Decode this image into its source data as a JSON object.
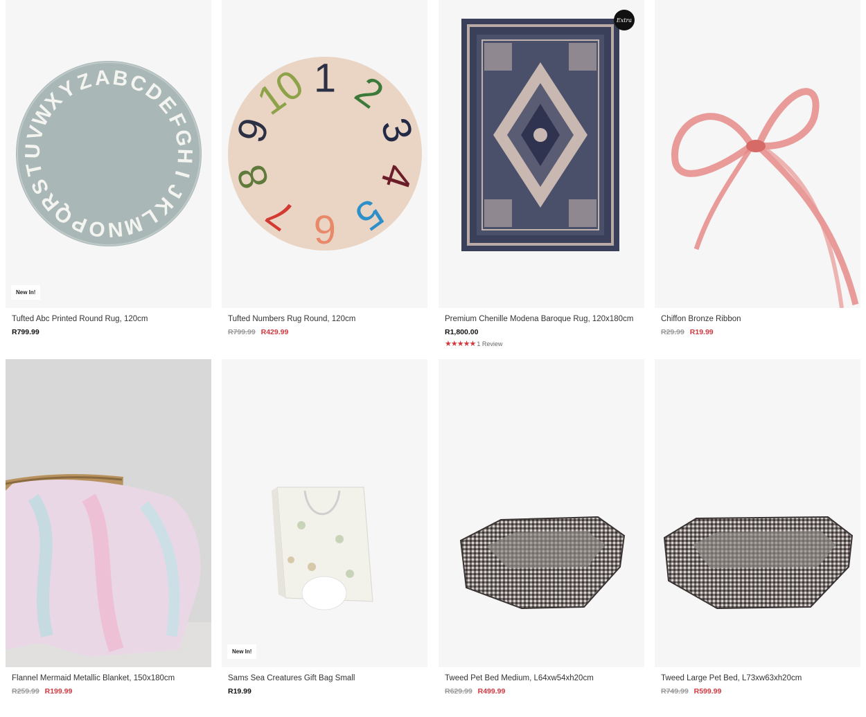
{
  "products": [
    {
      "title": "Tufted Abc Printed Round Rug, 120cm",
      "price": "R799.99",
      "badge": "New In!"
    },
    {
      "title": "Tufted Numbers Rug Round, 120cm",
      "old_price": "R799.99",
      "sale_price": "R429.99"
    },
    {
      "title": "Premium Chenille Modena Baroque Rug, 120x180cm",
      "price": "R1,800.00",
      "stars": "★★★★★",
      "rating_count": "1 Review",
      "logo_text": "Extra",
      "rating": 5
    },
    {
      "title": "Chiffon Bronze Ribbon",
      "old_price": "R29.99",
      "sale_price": "R19.99"
    },
    {
      "title": "Flannel Mermaid Metallic Blanket, 150x180cm",
      "old_price": "R259.99",
      "sale_price": "R199.99"
    },
    {
      "title": "Sams Sea Creatures Gift Bag Small",
      "price": "R19.99",
      "badge": "New In!"
    },
    {
      "title": "Tweed Pet Bed Medium, L64xw54xh20cm",
      "old_price": "R629.99",
      "sale_price": "R499.99"
    },
    {
      "title": "Tweed Large Pet Bed, L73xw63xh20cm",
      "old_price": "R749.99",
      "sale_price": "R599.99"
    }
  ],
  "rug_letters": "ABCDEFGHIJKLMNOPQRSTUVWXYZ",
  "rug_numbers": [
    "1",
    "2",
    "3",
    "4",
    "5",
    "6",
    "7",
    "8",
    "9",
    "10"
  ],
  "colors": {
    "sale": "#d0383f",
    "old": "#9a9a9a",
    "image_bg": "#f6f6f6"
  }
}
